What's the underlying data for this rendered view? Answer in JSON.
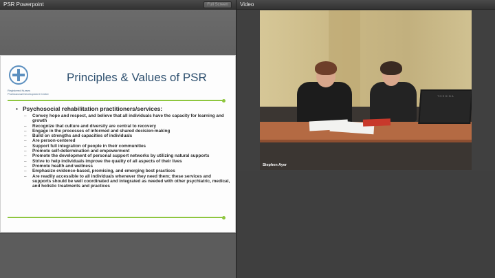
{
  "left_panel": {
    "title": "PSR Powerpoint",
    "fullscreen_label": "Full Screen"
  },
  "slide": {
    "logo_lines": [
      "Registered Nurses",
      "Professional Development Centre"
    ],
    "title": "Principles & Values of PSR",
    "bullet_main": "Psychosocial rehabilitation practitioners/services:",
    "sub_items": [
      "Convey hope and respect, and believe that all individuals have the capacity for learning and growth",
      "Recognize that culture and diversity are central to recovery",
      "Engage in the processes of informed and shared decision-making",
      "Build on strengths and capacities of individuals",
      "Are person-centered",
      "Support full integration of people in their communities",
      "Promote self-determination and empowerment",
      "Promote the development of personal support networks by utilizing natural supports",
      "Strive to help individuals improve the quality of all aspects of their lives",
      "Promote health and wellness",
      "Emphasize evidence-based, promising, and emerging best practices",
      "Are readily accessible to all individuals whenever they need them; these services and supports should be well coordinated and integrated as needed with other psychiatric, medical, and holistic treatments and practices"
    ],
    "accent_color": "#8ec63f",
    "title_color": "#2d4f6e"
  },
  "video_panel": {
    "title": "Video",
    "speaker_caption": "Stephen Ayer",
    "laptop_brand": "TOSHIBA"
  }
}
